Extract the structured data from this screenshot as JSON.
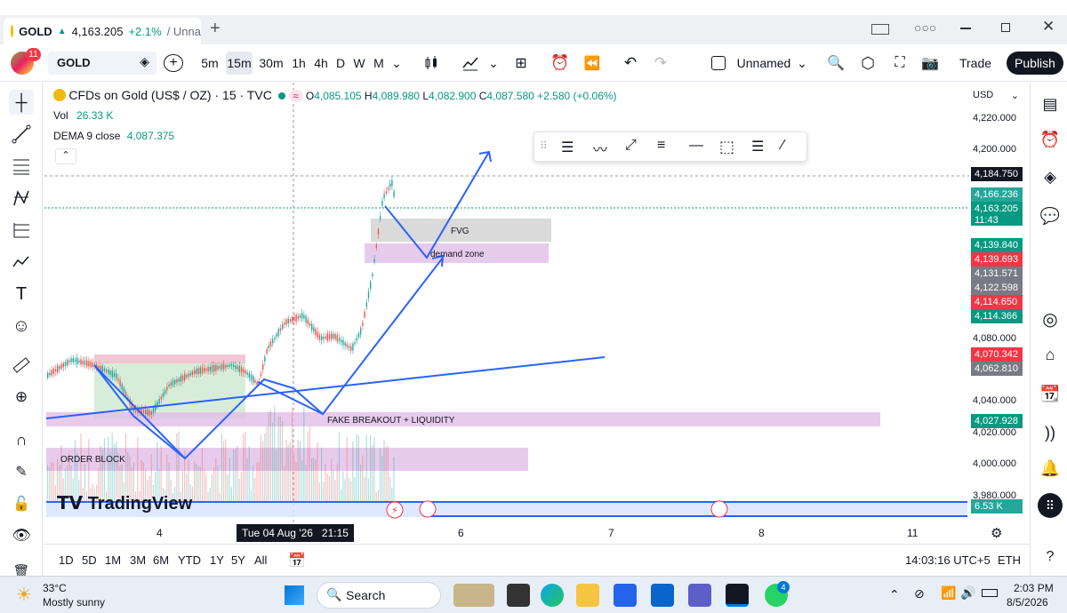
{
  "tab": {
    "symbol": "GOLD",
    "price": "4,163.205",
    "change": "+2.1%",
    "layout": "/ Unna"
  },
  "toolbar": {
    "avatar_badge": "11",
    "symbol_search": "GOLD",
    "intervals": [
      "5m",
      "15m",
      "30m",
      "1h",
      "4h",
      "D",
      "W",
      "M"
    ],
    "active_interval": "15m",
    "layout_name": "Unnamed",
    "trade_label": "Trade",
    "publish_label": "Publish"
  },
  "legend": {
    "title": "CFDs on Gold (US$ / OZ) · 15 · TVC",
    "o_label": "O",
    "o_value": "4,085.105",
    "h_label": "H",
    "h_value": "4,089.980",
    "l_label": "L",
    "l_value": "4,082.900",
    "c_label": "C",
    "c_value": "4,087.580",
    "change": "+2.580 (+0.06%)",
    "vol_label": "Vol",
    "vol_value": "26.33 K",
    "dema_label": "DEMA 9 close",
    "dema_value": "4,087.375"
  },
  "currency": "USD",
  "price_axis": [
    "4,220.000",
    "4,200.000",
    "4,080.000",
    "4,040.000",
    "4,020.000",
    "4,000.000",
    "3,980.000"
  ],
  "price_tags": [
    {
      "text": "4,184.750",
      "color": "#131722"
    },
    {
      "text": "4,166.236",
      "color": "#26a69a"
    },
    {
      "text": "4,163.205",
      "color": "#089981"
    },
    {
      "text": "11:43",
      "color": "#089981"
    },
    {
      "text": "4,139.840",
      "color": "#089981"
    },
    {
      "text": "4,139.693",
      "color": "#f23645"
    },
    {
      "text": "4,131.571",
      "color": "#787b86"
    },
    {
      "text": "4,122.598",
      "color": "#787b86"
    },
    {
      "text": "4,114.650",
      "color": "#f23645"
    },
    {
      "text": "4,114.366",
      "color": "#089981"
    },
    {
      "text": "4,070.342",
      "color": "#f23645"
    },
    {
      "text": "4,062.810",
      "color": "#787b86"
    },
    {
      "text": "4,027.928",
      "color": "#089981"
    },
    {
      "text": "6.53 K",
      "color": "#26a69a"
    }
  ],
  "annotations": {
    "fvg": "FVG",
    "demand": "demand zone",
    "fake": "FAKE BREAKOUT + LIQUIDITY",
    "order_block": "ORDER BLOCK"
  },
  "watermark": "TradingView",
  "time_axis": {
    "t4": "4",
    "cursor": "Tue 04 Aug '26   21:15",
    "t6": "6",
    "t7": "7",
    "t8": "8",
    "t11": "11"
  },
  "ranges": [
    "1D",
    "5D",
    "1M",
    "3M",
    "6M",
    "YTD",
    "1Y",
    "5Y",
    "All"
  ],
  "clock": "14:03:16 UTC+5",
  "session": "ETH",
  "taskbar": {
    "temp": "33°C",
    "weather": "Mostly sunny",
    "search": "Search",
    "whatsapp_badge": "4",
    "time": "2:03 PM",
    "date": "8/5/2026"
  },
  "colors": {
    "bull": "#26a69a",
    "bear": "#ef5350",
    "trend": "#2962ff",
    "zone_purple": "#e1bee7",
    "fvg_gray": "#d6d6d6"
  }
}
